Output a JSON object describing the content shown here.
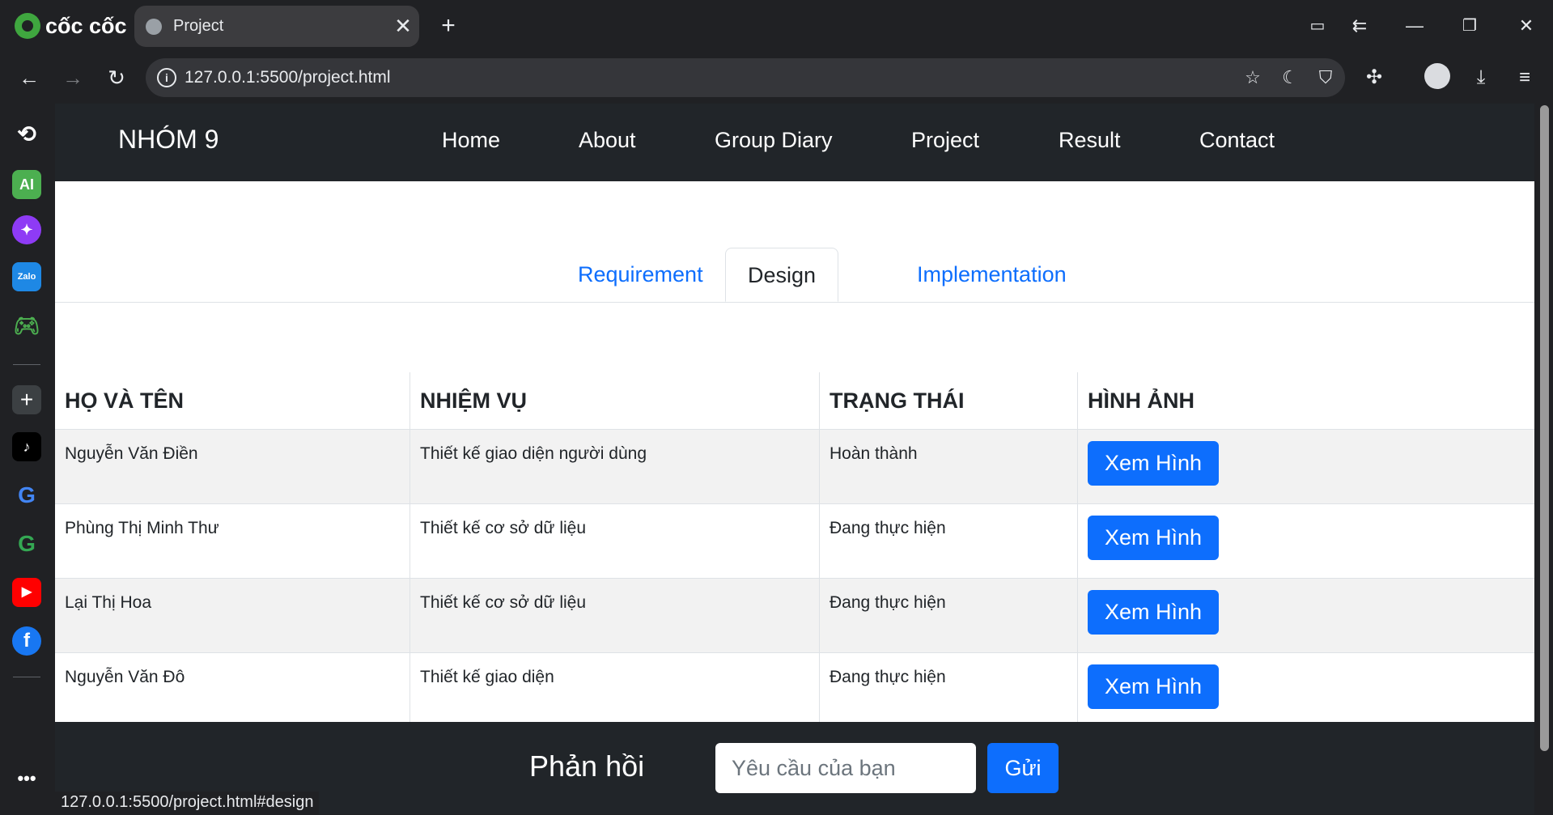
{
  "browser": {
    "brand": "cốc cốc",
    "tab_title": "Project",
    "url": "127.0.0.1:5500/project.html",
    "status_url": "127.0.0.1:5500/project.html#design"
  },
  "site": {
    "logo": "NHÓM 9",
    "nav": [
      "Home",
      "About",
      "Group Diary",
      "Project",
      "Result",
      "Contact"
    ]
  },
  "tabs": {
    "requirement": "Requirement",
    "design": "Design",
    "implementation": "Implementation",
    "active": "Design"
  },
  "table": {
    "headers": [
      "HỌ VÀ TÊN",
      "NHIỆM VỤ",
      "TRẠNG THÁI",
      "HÌNH ẢNH"
    ],
    "rows": [
      {
        "name": "Nguyễn Văn Điền",
        "task": "Thiết kế giao diện người dùng",
        "status": "Hoàn thành",
        "button": "Xem Hình"
      },
      {
        "name": "Phùng Thị Minh Thư",
        "task": "Thiết kế cơ sở dữ liệu",
        "status": "Đang thực hiện",
        "button": "Xem Hình"
      },
      {
        "name": "Lại Thị Hoa",
        "task": "Thiết kế cơ sở dữ liệu",
        "status": "Đang thực hiện",
        "button": "Xem Hình"
      },
      {
        "name": "Nguyễn Văn Đô",
        "task": "Thiết kế giao diện",
        "status": "Đang thực hiện",
        "button": "Xem Hình"
      }
    ]
  },
  "feedback": {
    "title": "Phản hồi",
    "placeholder": "Yêu cầu của bạn",
    "send": "Gửi"
  },
  "colors": {
    "primary": "#0d6efd",
    "navbar": "#212529",
    "browser": "#202124"
  }
}
